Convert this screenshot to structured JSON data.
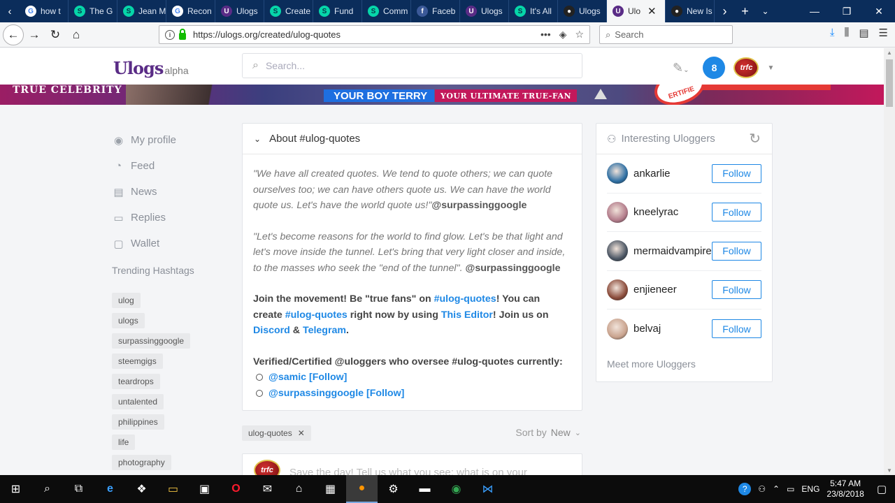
{
  "browser": {
    "tabs": [
      {
        "label": "how t",
        "icon": "google-icon",
        "color": "#ffffff",
        "glyph": "G",
        "fg": "#4285f4"
      },
      {
        "label": "The G",
        "icon": "steemit-icon",
        "color": "#06d6a9",
        "glyph": "S",
        "fg": "#06384a"
      },
      {
        "label": "Jean M",
        "icon": "steemit-icon",
        "color": "#06d6a9",
        "glyph": "S",
        "fg": "#06384a"
      },
      {
        "label": "Recon",
        "icon": "google-icon",
        "color": "#ffffff",
        "glyph": "G",
        "fg": "#4285f4"
      },
      {
        "label": "Ulogs",
        "icon": "ulogs-icon",
        "color": "#5a2c86",
        "glyph": "U",
        "fg": "#ffffff"
      },
      {
        "label": "Create",
        "icon": "steemit-icon",
        "color": "#06d6a9",
        "glyph": "S",
        "fg": "#06384a"
      },
      {
        "label": "Fund",
        "icon": "steemit-icon",
        "color": "#06d6a9",
        "glyph": "S",
        "fg": "#06384a"
      },
      {
        "label": "Comm",
        "icon": "steemit-icon",
        "color": "#06d6a9",
        "glyph": "S",
        "fg": "#06384a"
      },
      {
        "label": "Faceb",
        "icon": "facebook-icon",
        "color": "#3b5998",
        "glyph": "f",
        "fg": "#ffffff"
      },
      {
        "label": "Ulogs",
        "icon": "ulogs-icon",
        "color": "#5a2c86",
        "glyph": "U",
        "fg": "#ffffff"
      },
      {
        "label": "It's All",
        "icon": "steemit-icon",
        "color": "#06d6a9",
        "glyph": "S",
        "fg": "#06384a"
      },
      {
        "label": "Ulogs",
        "icon": "github-icon",
        "color": "#222222",
        "glyph": "●",
        "fg": "#ffffff"
      },
      {
        "label": "Ulo",
        "icon": "ulogs-icon",
        "color": "#5a2c86",
        "glyph": "U",
        "fg": "#ffffff",
        "active": true
      },
      {
        "label": "New Is",
        "icon": "github-icon",
        "color": "#222222",
        "glyph": "●",
        "fg": "#ffffff"
      }
    ],
    "url": "https://ulogs.org/created/ulog-quotes",
    "search_placeholder": "Search"
  },
  "site": {
    "logo_text": "Ulogs",
    "logo_suffix": "alpha",
    "search_placeholder": "Search...",
    "notification_count": "8",
    "avatar_label": "trfc"
  },
  "banner": {
    "left_text": "TRUE CELEBRITY",
    "mid_text": "YOUR BOY TERRY",
    "right_text": "YOUR ULTIMATE TRUE-FAN",
    "stamp_text": "ERTIFIE"
  },
  "sidebar": {
    "items": [
      {
        "label": "My profile",
        "icon": "profile-icon"
      },
      {
        "label": "Feed",
        "icon": "feed-icon"
      },
      {
        "label": "News",
        "icon": "news-icon"
      },
      {
        "label": "Replies",
        "icon": "replies-icon"
      },
      {
        "label": "Wallet",
        "icon": "wallet-icon"
      }
    ],
    "trending_heading": "Trending Hashtags",
    "hashtags": [
      "ulog",
      "ulogs",
      "surpassinggoogle",
      "steemgigs",
      "teardrops",
      "untalented",
      "philippines",
      "life",
      "photography"
    ]
  },
  "about": {
    "title": "About #ulog-quotes",
    "quote1": "\"We have all created quotes. We tend to quote others; we can quote ourselves too; we can have others quote us. We can have the world quote us. Let's have the world quote us!\"",
    "quote1_attr": "@surpassinggoogle",
    "quote2": "\"Let's become reasons for the world to find glow. Let's be that light and let's move inside the tunnel. Let's bring that very light closer and inside, to the masses who seek the \"end of the tunnel\".",
    "quote2_attr": "@surpassinggoogle",
    "join_1": "Join the movement! Be \"true fans\" on ",
    "join_link_tag": "#ulog-quotes",
    "join_2": "! You can create ",
    "join_link_tag2": "#ulog-quotes",
    "join_3": " right now by using ",
    "join_link_editor": "This Editor",
    "join_4": "! Join us on ",
    "join_link_discord": "Discord",
    "join_5": " & ",
    "join_link_telegram": "Telegram",
    "join_6": ".",
    "verified_heading": "Verified/Certified @uloggers who oversee #ulog-quotes currently:",
    "verified": [
      "@samic [Follow]",
      "@surpassinggoogle [Follow]"
    ]
  },
  "feed": {
    "filter_tag": "ulog-quotes",
    "sort_label": "Sort by",
    "sort_value": "New",
    "composer_placeholder": "Save the day! Tell us what you see; what is on your"
  },
  "uloggers": {
    "title": "Interesting Uloggers",
    "follow_label": "Follow",
    "users": [
      {
        "name": "ankarlie",
        "avatar_color": "#2e6fa3"
      },
      {
        "name": "kneelyrac",
        "avatar_color": "#b27b8a"
      },
      {
        "name": "mermaidvampire",
        "avatar_color": "#4a5563"
      },
      {
        "name": "enjieneer",
        "avatar_color": "#8a4b3a"
      },
      {
        "name": "belvaj",
        "avatar_color": "#c9a38e"
      }
    ],
    "meet_more": "Meet more Uloggers"
  },
  "taskbar": {
    "language": "ENG",
    "time": "5:47 AM",
    "date": "23/8/2018"
  }
}
